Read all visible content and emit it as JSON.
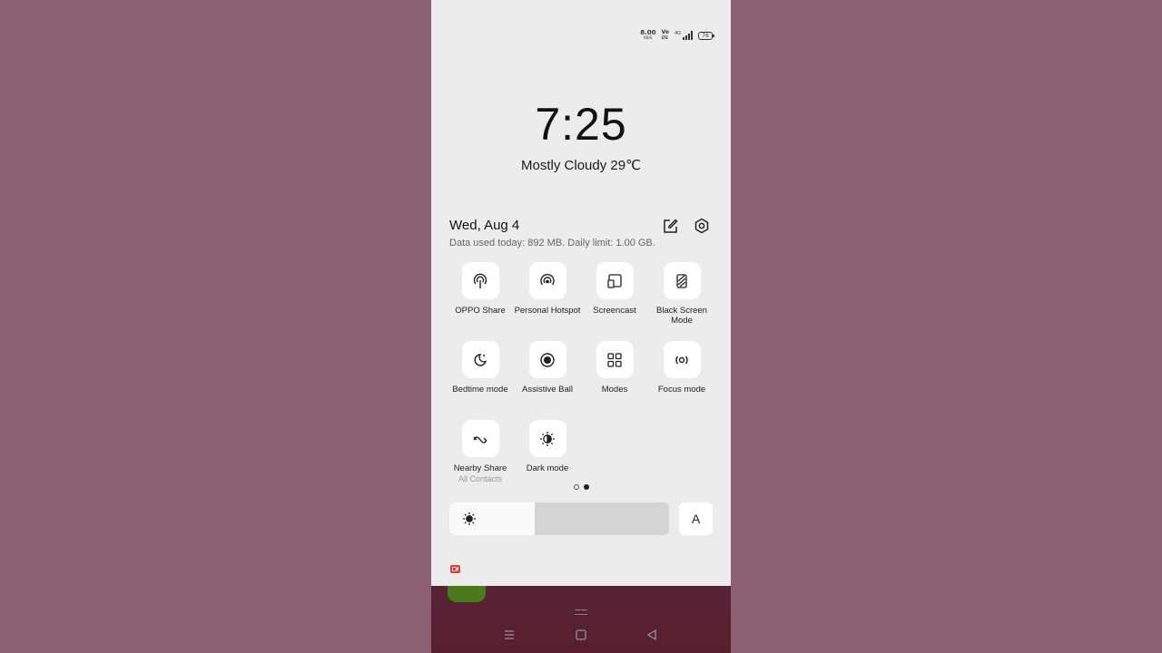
{
  "status_bar": {
    "net_speed_value": "8.00",
    "net_speed_unit": "KB/S",
    "volte_top": "Vo",
    "volte_bottom": "LTE",
    "network_type": "4G",
    "battery_level": "76",
    "icons": [
      "volte-icon",
      "signal-icon",
      "battery-icon"
    ]
  },
  "lockscreen": {
    "time": "7:25",
    "weather": "Mostly Cloudy 29℃"
  },
  "quick_settings": {
    "date": "Wed, Aug 4",
    "data_usage": "Data used today: 892 MB. Daily limit: 1.00 GB.",
    "header_icons": [
      "edit-icon",
      "settings-gear-icon"
    ],
    "tiles": [
      {
        "label": "OPPO Share",
        "icon": "oppo-share-icon"
      },
      {
        "label": "Personal Hotspot",
        "icon": "hotspot-icon"
      },
      {
        "label": "Screencast",
        "icon": "screencast-icon"
      },
      {
        "label": "Black Screen Mode",
        "icon": "black-screen-icon"
      },
      {
        "label": "Bedtime mode",
        "icon": "bedtime-moon-icon"
      },
      {
        "label": "Assistive Ball",
        "icon": "assistive-ball-icon"
      },
      {
        "label": "Modes",
        "icon": "modes-grid-icon"
      },
      {
        "label": "Focus mode",
        "icon": "focus-mode-icon"
      },
      {
        "label": "Nearby Share",
        "sublabel": "All Contacts",
        "icon": "nearby-share-icon"
      },
      {
        "label": "Dark mode",
        "icon": "dark-mode-icon"
      }
    ],
    "page_indicator": {
      "pages": 2,
      "current": 2
    },
    "brightness": {
      "level": 0.39,
      "icon": "brightness-sun-icon"
    },
    "auto_brightness_label": "A"
  },
  "navigation": {
    "icons": [
      "recents-icon",
      "home-icon",
      "back-icon"
    ]
  },
  "colors": {
    "wallpaper": "#8c5f72",
    "panel": "#ececec",
    "tile_bg": "#ffffff",
    "record_indicator": "#e53935"
  }
}
